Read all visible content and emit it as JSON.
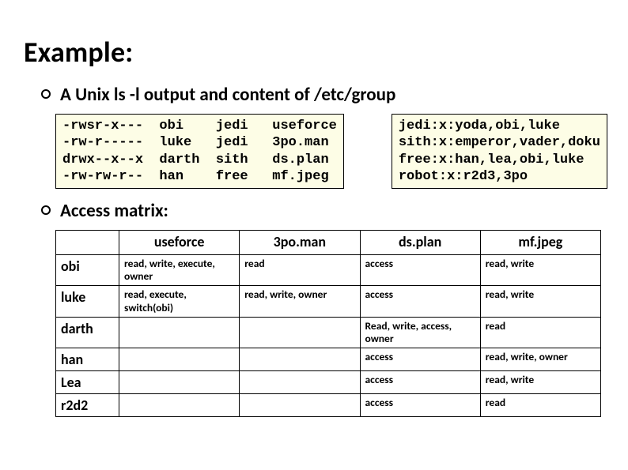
{
  "title": "Example:",
  "bullet1": "A Unix ls -l output and content of /etc/group",
  "bullet2": "Access matrix:",
  "ls_output": "-rwsr-x---  obi    jedi   useforce\n-rw-r-----  luke   jedi   3po.man\ndrwx--x--x  darth  sith   ds.plan\n-rw-rw-r--  han    free   mf.jpeg",
  "group_output": "jedi:x:yoda,obi,luke\nsith:x:emperor,vader,doku\nfree:x:han,lea,obi,luke\nrobot:x:r2d3,3po",
  "matrix": {
    "columns": [
      "useforce",
      "3po.man",
      "ds.plan",
      "mf.jpeg"
    ],
    "rows": [
      {
        "name": "obi",
        "cells": [
          "read, write, execute, owner",
          "read",
          "access",
          "read, write"
        ]
      },
      {
        "name": "luke",
        "cells": [
          "read, execute, switch(obi)",
          "read, write, owner",
          "access",
          "read, write"
        ]
      },
      {
        "name": "darth",
        "cells": [
          "",
          "",
          "Read, write, access, owner",
          "read"
        ]
      },
      {
        "name": "han",
        "cells": [
          "",
          "",
          "access",
          "read, write, owner"
        ]
      },
      {
        "name": "Lea",
        "cells": [
          "",
          "",
          "access",
          "read, write"
        ]
      },
      {
        "name": "r2d2",
        "cells": [
          "",
          "",
          "access",
          "read"
        ]
      }
    ]
  }
}
